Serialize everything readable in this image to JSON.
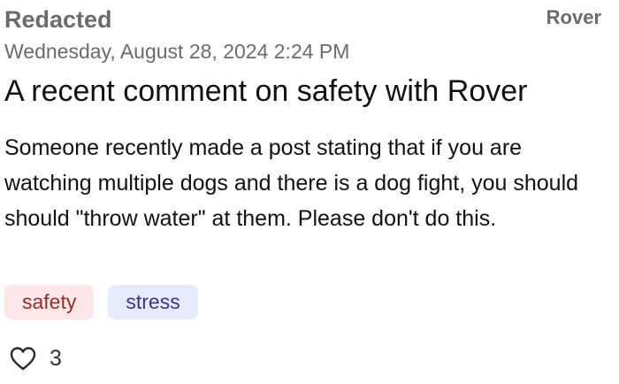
{
  "post": {
    "author": "Redacted",
    "community": "Rover",
    "timestamp": "Wednesday, August 28, 2024 2:24 PM",
    "title": "A recent comment on safety with Rover",
    "body": "Someone recently made a post stating that if you are watching multiple dogs and there is a dog fight, you should should \"throw water\" at them. Please don't do this.",
    "tags": [
      {
        "label": "safety",
        "color": "#9b2c2c",
        "background": "#fbe7e7"
      },
      {
        "label": "stress",
        "color": "#3b3493",
        "background": "#e7ecfb"
      }
    ],
    "like_icon": "heart-outline-icon",
    "like_count": "3"
  }
}
